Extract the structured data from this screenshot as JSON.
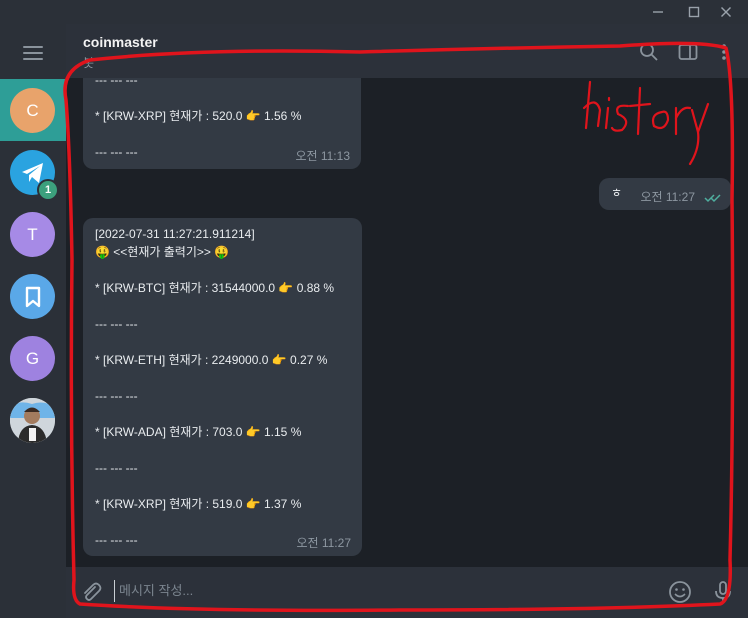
{
  "window": {
    "controls": [
      "minimize-icon",
      "maximize-icon",
      "close-icon"
    ]
  },
  "sidebar": {
    "menu_icon": "hamburger-icon",
    "chats": [
      {
        "letter": "C",
        "color": "#e8a36b",
        "active": true
      },
      {
        "letter": "",
        "icon": "telegram-icon",
        "color": "#2aa3e0",
        "badge": "1"
      },
      {
        "letter": "T",
        "color": "#a68ae6"
      },
      {
        "letter": "",
        "icon": "bookmark-icon",
        "color": "#5aa8e8"
      },
      {
        "letter": "G",
        "color": "#9e82e0"
      },
      {
        "letter": "",
        "icon": "profile-photo",
        "color": "#d8d8d8"
      }
    ]
  },
  "header": {
    "title": "coinmaster",
    "status": "봇",
    "icons": [
      "search-icon",
      "sidebar-toggle-icon",
      "more-vert-icon"
    ]
  },
  "messages": [
    {
      "lines": [
        "--- --- ---",
        "",
        "* [KRW-XRP] 현재가 : 520.0 👉 1.56 %",
        "",
        "--- --- ---"
      ],
      "time": "오전 11:13"
    },
    {
      "lines": [
        "ㅎ"
      ],
      "time": "오전 11:27",
      "outgoing": true
    },
    {
      "lines": [
        "[2022-07-31 11:27:21.911214]",
        "🤑 <<현재가 출력기>> 🤑",
        "",
        "* [KRW-BTC] 현재가 : 31544000.0 👉 0.88 %",
        "",
        "--- --- ---",
        "",
        "* [KRW-ETH] 현재가 : 2249000.0 👉 0.27 %",
        "",
        "--- --- ---",
        "",
        "* [KRW-ADA] 현재가 : 703.0 👉 1.15 %",
        "",
        "--- --- ---",
        "",
        "* [KRW-XRP] 현재가 : 519.0 👉 1.37 %",
        "",
        "--- --- ---"
      ],
      "time": "오전 11:27"
    }
  ],
  "composer": {
    "placeholder": "메시지 작성...",
    "icons": [
      "attach-icon",
      "emoji-icon",
      "microphone-icon"
    ]
  },
  "annotation": {
    "label": "history",
    "color": "#e0141c"
  }
}
